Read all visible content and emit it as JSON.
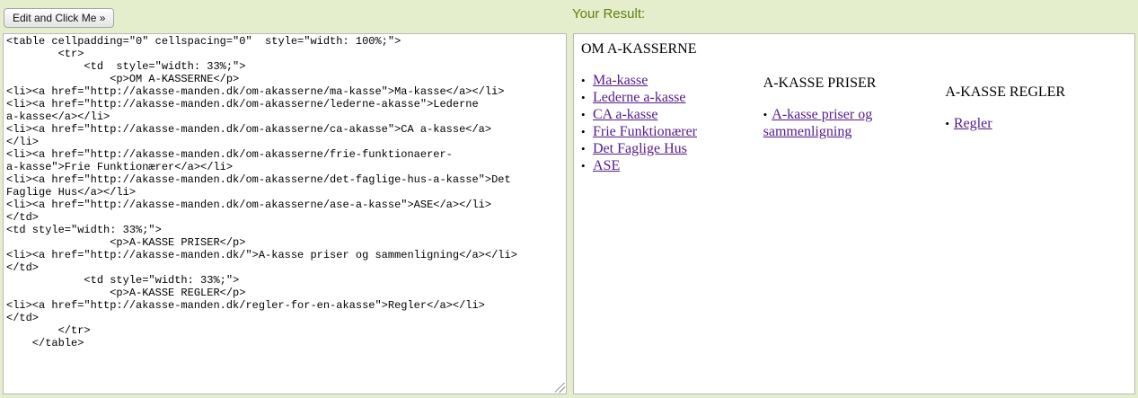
{
  "toolbar": {
    "run_label": "Edit and Click Me »",
    "result_heading": "Your Result:"
  },
  "editor": {
    "code": "<table cellpadding=\"0\" cellspacing=\"0\"  style=\"width: 100%;\">\n        <tr>\n            <td  style=\"width: 33%;\">\n                <p>OM A-KASSERNE</p>\n<li><a href=\"http://akasse-manden.dk/om-akasserne/ma-kasse\">Ma-kasse</a></li>\n<li><a href=\"http://akasse-manden.dk/om-akasserne/lederne-akasse\">Lederne\na-kasse</a></li>\n<li><a href=\"http://akasse-manden.dk/om-akasserne/ca-akasse\">CA a-kasse</a>\n</li>\n<li><a href=\"http://akasse-manden.dk/om-akasserne/frie-funktionaerer-\na-kasse\">Frie Funktionærer</a></li>\n<li><a href=\"http://akasse-manden.dk/om-akasserne/det-faglige-hus-a-kasse\">Det\nFaglige Hus</a></li>\n<li><a href=\"http://akasse-manden.dk/om-akasserne/ase-a-kasse\">ASE</a></li>\n</td>\n<td style=\"width: 33%;\">\n                <p>A-KASSE PRISER</p>\n<li><a href=\"http://akasse-manden.dk/\">A-kasse priser og sammenligning</a></li>\n</td>\n            <td style=\"width: 33%;\">\n                <p>A-KASSE REGLER</p>\n<li><a href=\"http://akasse-manden.dk/regler-for-en-akasse\">Regler</a></li>\n</td>\n        </tr>\n    </table>"
  },
  "result": {
    "col1": {
      "title": "OM A-KASSERNE",
      "links": [
        "Ma-kasse",
        "Lederne a-kasse",
        "CA a-kasse",
        "Frie Funktionærer",
        "Det Faglige Hus",
        "ASE"
      ]
    },
    "col2": {
      "title": "A-KASSE PRISER",
      "link": "A-kasse priser og sammenligning"
    },
    "col3": {
      "title": "A-KASSE REGLER",
      "link": "Regler"
    }
  },
  "colors": {
    "background": "#e5eecc",
    "heading_green": "#617f10",
    "visited_link": "#551a8b"
  }
}
